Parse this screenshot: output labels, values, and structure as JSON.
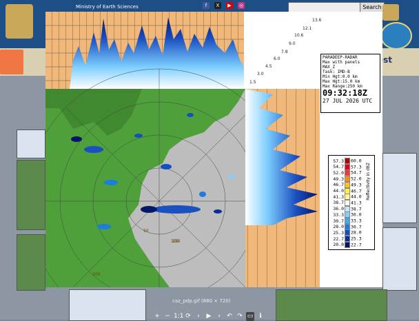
{
  "site": {
    "ministry_text": "Ministry of Earth Sciences",
    "search_placeholder": "",
    "search_button": "Search",
    "nav_partial_text": "est"
  },
  "viewer": {
    "caption": "caz_pdp.gif (880 × 720)",
    "toolbar_icons": [
      "zoom-in-icon",
      "zoom-out-icon",
      "actual-size-icon",
      "rotate-icon",
      "prev-icon",
      "play-icon",
      "next-icon",
      "rotate-left-icon",
      "rotate-right-icon",
      "fullscreen-icon",
      "info-icon"
    ],
    "toolbar_glyphs": [
      "+",
      "−",
      "1:1",
      "⟳",
      "‹",
      "▶",
      "›",
      "↶",
      "↷",
      "▭",
      "ℹ"
    ]
  },
  "radar": {
    "station": "PARADEEP-RADAR",
    "product": "Max with panels",
    "mode": "MAX_Z",
    "task": "Task: IMD-B",
    "min_hgt": "Min Hgt:0.0 km",
    "max_hgt": "Max Hgt:15.0 km",
    "max_range": "Max Range:250 km",
    "time": "09:32:18Z",
    "date": "27 JUL 2026 UTC",
    "height_labels": [
      "13.6",
      "12.1",
      "10.6",
      "9.0",
      "7.8",
      "6.0",
      "4.5",
      "3.0",
      "1.5"
    ],
    "range_labels": [
      "50",
      "100",
      "150",
      "200"
    ]
  },
  "legend": {
    "title": "Reflectivity in dBZ",
    "rows": [
      {
        "lo": "57.3",
        "hi": "60.0",
        "color": "#b00000"
      },
      {
        "lo": "54.7",
        "hi": "57.3",
        "color": "#e0001a"
      },
      {
        "lo": "52.0",
        "hi": "54.7",
        "color": "#ff3030"
      },
      {
        "lo": "49.3",
        "hi": "52.0",
        "color": "#ff8a1a"
      },
      {
        "lo": "46.7",
        "hi": "49.3",
        "color": "#ffc21a"
      },
      {
        "lo": "44.0",
        "hi": "46.7",
        "color": "#fff23a"
      },
      {
        "lo": "41.3",
        "hi": "44.0",
        "color": "#fffa9a"
      },
      {
        "lo": "38.7",
        "hi": "41.3",
        "color": "#ffffff"
      },
      {
        "lo": "36.0",
        "hi": "38.7",
        "color": "#bfe8ff"
      },
      {
        "lo": "33.3",
        "hi": "36.0",
        "color": "#7fcfff"
      },
      {
        "lo": "30.7",
        "hi": "33.3",
        "color": "#40aaf0"
      },
      {
        "lo": "28.0",
        "hi": "30.7",
        "color": "#1a7ee0"
      },
      {
        "lo": "25.3",
        "hi": "28.0",
        "color": "#1050c0"
      },
      {
        "lo": "22.7",
        "hi": "25.3",
        "color": "#0a2f9a"
      },
      {
        "lo": "20.0",
        "hi": "22.7",
        "color": "#06156a"
      }
    ]
  }
}
